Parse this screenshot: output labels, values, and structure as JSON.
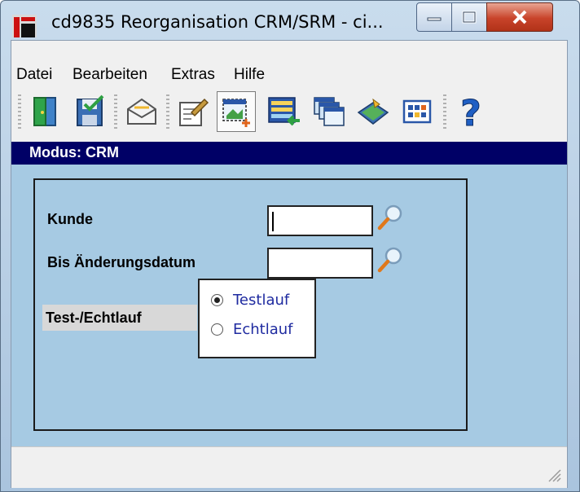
{
  "window": {
    "title": "cd9835 Reorganisation CRM/SRM - ci...",
    "controls": {
      "minimize_icon": "minimize-icon",
      "maximize_icon": "maximize-icon",
      "close_icon": "close-icon"
    }
  },
  "menu": [
    "Datei",
    "Bearbeiten",
    "Extras",
    "Hilfe"
  ],
  "toolbar": [
    {
      "name": "exit-door-icon"
    },
    {
      "name": "save-icon"
    },
    {
      "name": "mail-icon"
    },
    {
      "name": "edit-document-icon"
    },
    {
      "name": "new-window-icon",
      "pressed": true
    },
    {
      "name": "list-transfer-icon"
    },
    {
      "name": "cascade-windows-icon"
    },
    {
      "name": "book-icon"
    },
    {
      "name": "calendar-grid-icon"
    },
    {
      "name": "help-icon"
    }
  ],
  "mode": {
    "label": "Modus: CRM"
  },
  "form": {
    "kunde_label": "Kunde",
    "kunde_value": "",
    "datum_label": "Bis Änderungsdatum",
    "datum_value": "",
    "run_label": "Test-/Echtlauf",
    "options": [
      {
        "label": "Testlauf",
        "selected": true
      },
      {
        "label": "Echtlauf",
        "selected": false
      }
    ]
  },
  "colors": {
    "mode_bar": "#000066",
    "content_bg": "#a6cae3",
    "radio_text": "#1f2ba0"
  }
}
